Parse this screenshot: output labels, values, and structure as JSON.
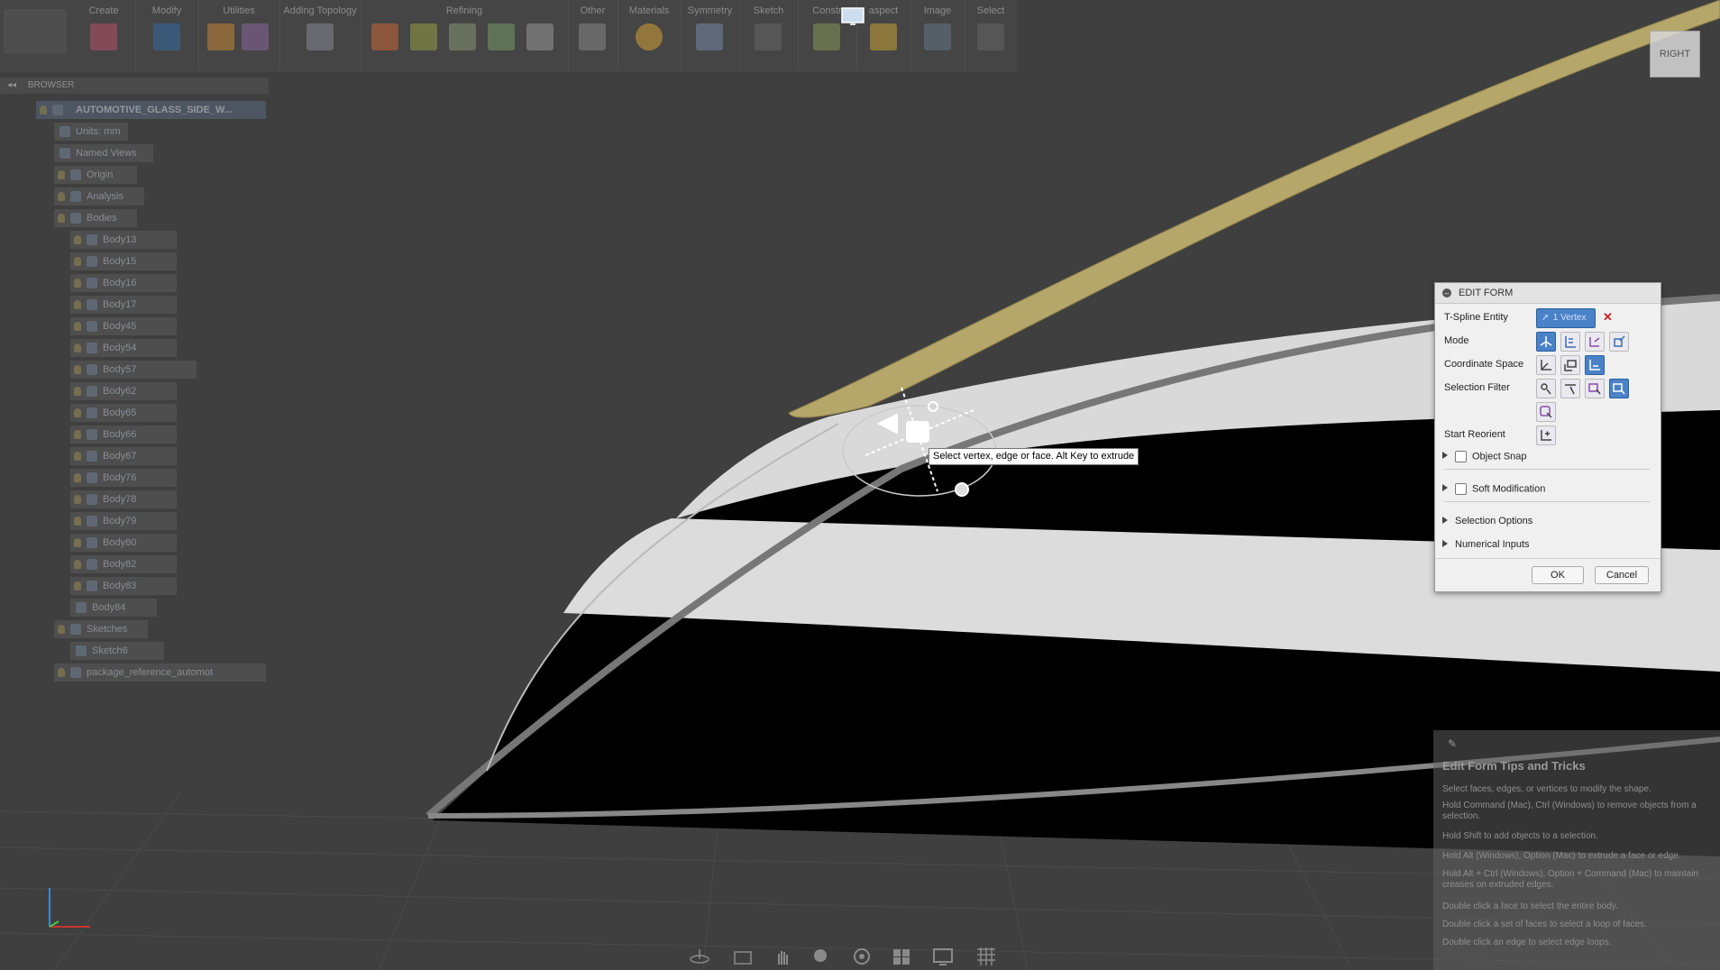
{
  "toolbar": {
    "groups": [
      {
        "label": "Create"
      },
      {
        "label": "Modify"
      },
      {
        "label": "Utilities"
      },
      {
        "label": "Adding Topology"
      },
      {
        "label": "Refining"
      },
      {
        "label": "Other"
      },
      {
        "label": "Materials"
      },
      {
        "label": "Symmetry"
      },
      {
        "label": "Sketch"
      },
      {
        "label": "Constr"
      },
      {
        "label": "aspect"
      },
      {
        "label": "Image"
      },
      {
        "label": "Select"
      }
    ]
  },
  "browser": {
    "title": "BROWSER",
    "root": "AUTOMOTIVE_GLASS_SIDE_W...",
    "items": [
      {
        "label": "Units: mm"
      },
      {
        "label": "Named Views"
      },
      {
        "label": "Origin"
      },
      {
        "label": "Analysis"
      },
      {
        "label": "Bodies"
      }
    ],
    "bodies": [
      {
        "label": "Body13"
      },
      {
        "label": "Body15"
      },
      {
        "label": "Body16"
      },
      {
        "label": "Body17"
      },
      {
        "label": "Body45"
      },
      {
        "label": "Body54"
      },
      {
        "label": "Body57"
      },
      {
        "label": "Body62"
      },
      {
        "label": "Body65"
      },
      {
        "label": "Body66"
      },
      {
        "label": "Body67"
      },
      {
        "label": "Body76"
      },
      {
        "label": "Body78"
      },
      {
        "label": "Body79"
      },
      {
        "label": "Body80"
      },
      {
        "label": "Body82"
      },
      {
        "label": "Body83"
      },
      {
        "label": "Body84"
      }
    ],
    "sketches": "Sketches",
    "sketch": "Sketch6",
    "reference": "package_reference_automot"
  },
  "edit_form": {
    "title": "EDIT FORM",
    "tspline_label": "T-Spline Entity",
    "tspline_value": "1 Vertex",
    "mode_label": "Mode",
    "coord_label": "Coordinate Space",
    "filter_label": "Selection Filter",
    "reorient_label": "Start Reorient",
    "object_snap": "Object Snap",
    "soft_mod": "Soft Modification",
    "selection_options": "Selection Options",
    "numerical_inputs": "Numerical Inputs",
    "ok": "OK",
    "cancel": "Cancel"
  },
  "tooltip": "Select vertex, edge or face. Alt Key to extrude",
  "view_cube": "RIGHT",
  "tips": {
    "title": "Edit Form Tips and Tricks",
    "lines": [
      "Select faces, edges, or vertices to modify the shape.",
      "Hold Command (Mac), Ctrl (Windows) to remove objects from a selection.",
      "Hold Shift to add objects to a selection.",
      "Hold Alt (Windows), Option (Mac) to extrude a face or edge.",
      "Hold Alt + Ctrl (Windows), Option + Command (Mac) to maintain creases on extruded edges.",
      "Double click a face to select the entire body.",
      "Double click a set of faces to select a loop of faces.",
      "Double click an edge to select edge loops."
    ]
  },
  "colors": {
    "background": "#3f3f3f",
    "accent": "#4a82c8",
    "glass_top": "#b5a66a",
    "glass_white": "#d9d9d9"
  }
}
